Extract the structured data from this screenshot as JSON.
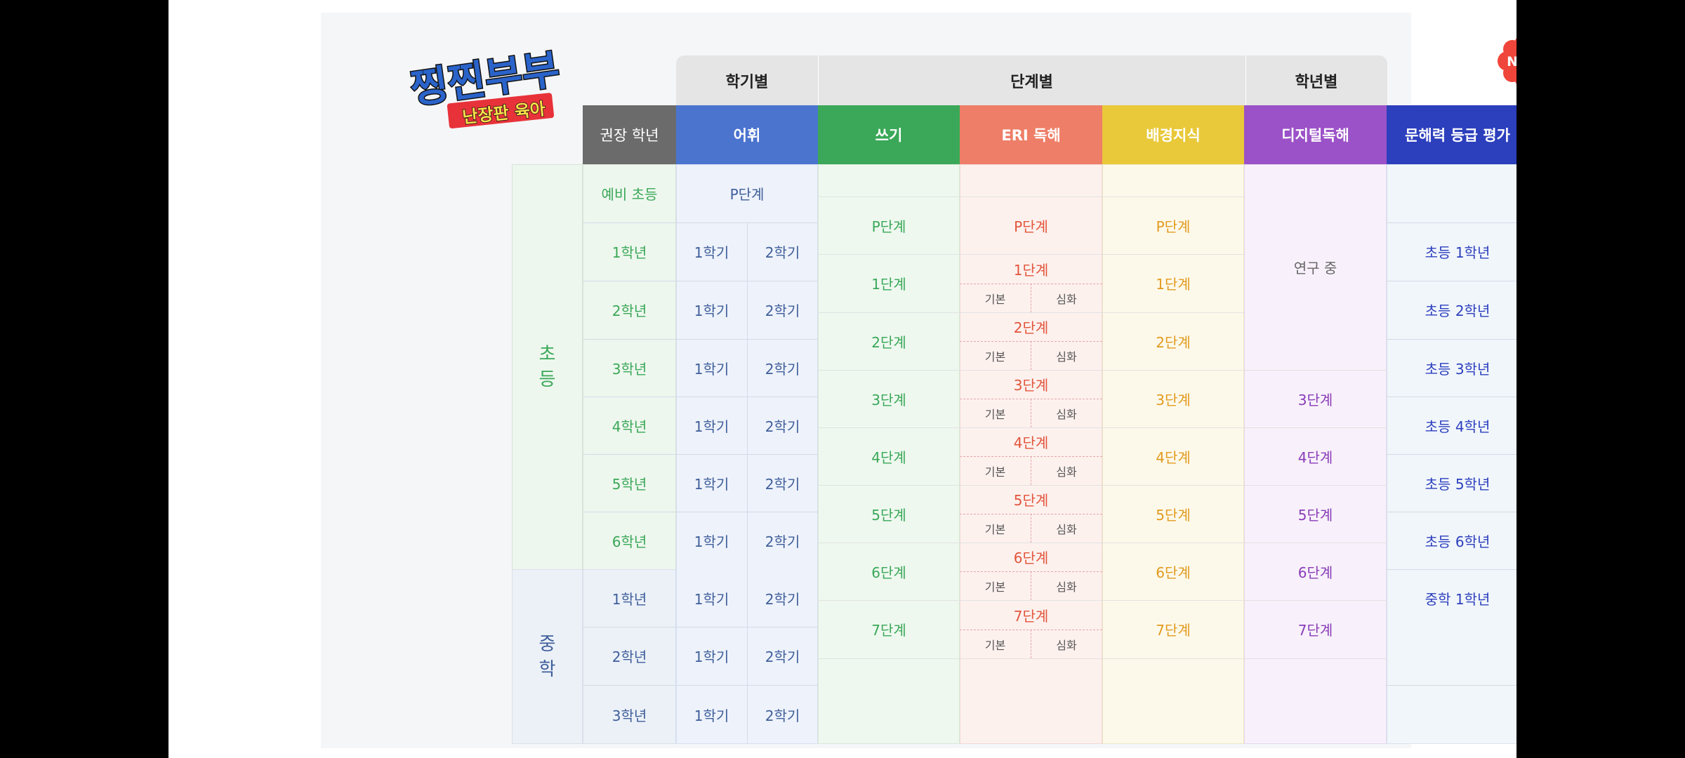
{
  "top_headers": {
    "semester": "학기별",
    "level": "단계별",
    "grade": "학년별"
  },
  "column_headers": {
    "recommended": "권장 학년",
    "vocab": "어휘",
    "writing": "쓰기",
    "eri": "ERI 독해",
    "background": "배경지식",
    "digital": "디지털독해",
    "literacy": "문해력 등급 평가"
  },
  "groups": {
    "elementary": "초\n등",
    "middle": "중\n학"
  },
  "grades": [
    "예비 초등",
    "1학년",
    "2학년",
    "3학년",
    "4학년",
    "5학년",
    "6학년",
    "1학년",
    "2학년",
    "3학년"
  ],
  "vocab": {
    "pre": "P단계",
    "sem1": "1학기",
    "sem2": "2학기"
  },
  "writing": [
    "P단계",
    "1단계",
    "2단계",
    "3단계",
    "4단계",
    "5단계",
    "6단계",
    "7단계"
  ],
  "eri": [
    "P단계",
    "1단계",
    "2단계",
    "3단계",
    "4단계",
    "5단계",
    "6단계",
    "7단계"
  ],
  "eri_sub": {
    "basic": "기본",
    "advanced": "심화"
  },
  "background": [
    "P단계",
    "1단계",
    "2단계",
    "3단계",
    "4단계",
    "5단계",
    "6단계",
    "7단계"
  ],
  "digital": {
    "research": "연구 중",
    "levels": [
      "3단계",
      "4단계",
      "5단계",
      "6단계",
      "7단계"
    ]
  },
  "literacy": [
    "초등 1학년",
    "초등 2학년",
    "초등 3학년",
    "초등 4학년",
    "초등 5학년",
    "초등 6학년",
    "중학 1학년"
  ],
  "logo": {
    "main": "찡찐부부",
    "sub": "난장판 육아"
  },
  "badge": "NEW",
  "colors": {
    "recommended": "#6b6b6b",
    "vocab": "#4b74cf",
    "writing": "#3aa858",
    "eri": "#ee7e67",
    "background": "#e9c93a",
    "digital": "#9b51c7",
    "literacy": "#2c3fbd"
  }
}
